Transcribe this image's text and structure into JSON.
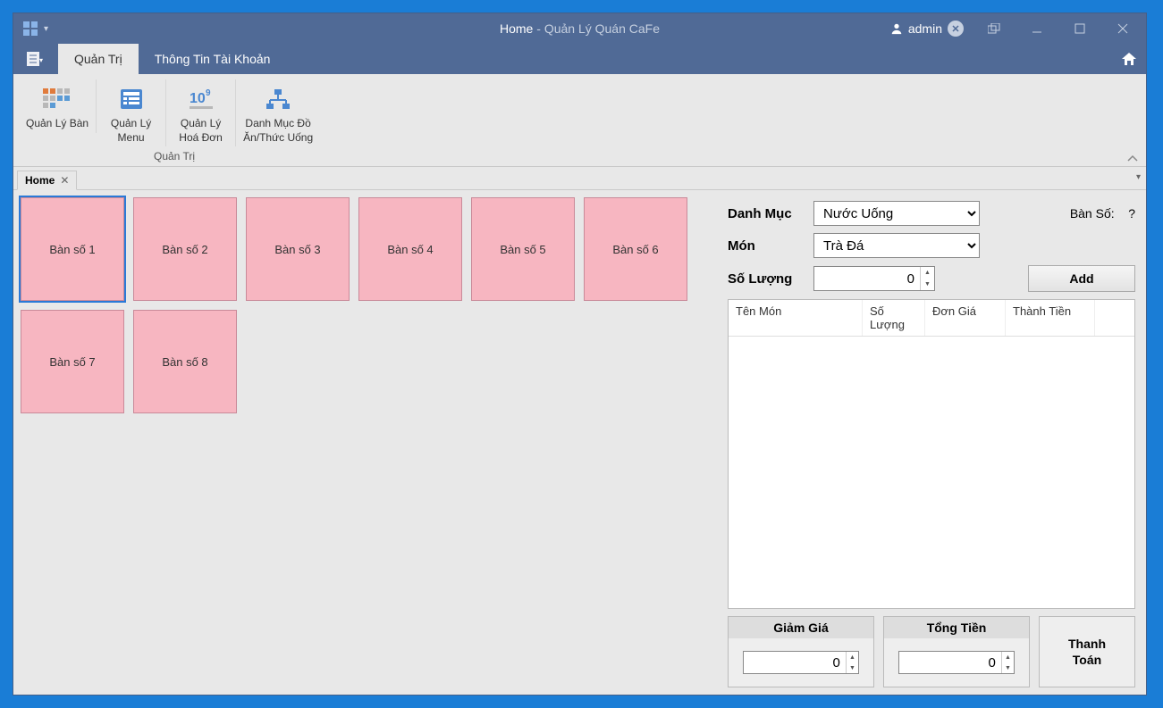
{
  "title": {
    "page": "Home",
    "app": "Quản Lý Quán CaFe"
  },
  "user": "admin",
  "menu": {
    "tabs": [
      "Quản Trị",
      "Thông Tin Tài Khoản"
    ]
  },
  "ribbon": {
    "caption": "Quản Trị",
    "items": [
      {
        "label": "Quản Lý Bàn"
      },
      {
        "label1": "Quản Lý",
        "label2": "Menu"
      },
      {
        "label1": "Quản Lý",
        "label2": "Hoá Đơn"
      },
      {
        "label1": "Danh Mục Đồ",
        "label2": "Ăn/Thức Uống"
      }
    ]
  },
  "docTab": "Home",
  "tables": [
    "Bàn số 1",
    "Bàn số 2",
    "Bàn số 3",
    "Bàn số 4",
    "Bàn số 5",
    "Bàn số 6",
    "Bàn số 7",
    "Bàn số 8"
  ],
  "form": {
    "danhmuc_label": "Danh Mục",
    "danhmuc_value": "Nước Uống",
    "mon_label": "Món",
    "mon_value": "Trà Đá",
    "soluong_label": "Số Lượng",
    "soluong_value": "0",
    "ban_so_label": "Bàn Số:",
    "ban_so_value": "?",
    "add_label": "Add"
  },
  "grid": {
    "headers": [
      "Tên Món",
      "Số Lượng",
      "Đơn Giá",
      "Thành Tiền"
    ]
  },
  "totals": {
    "giamgia_label": "Giảm Giá",
    "giamgia_value": "0",
    "tongtien_label": "Tổng Tiền",
    "tongtien_value": "0",
    "thanhtoan_label": "Thanh Toán"
  }
}
